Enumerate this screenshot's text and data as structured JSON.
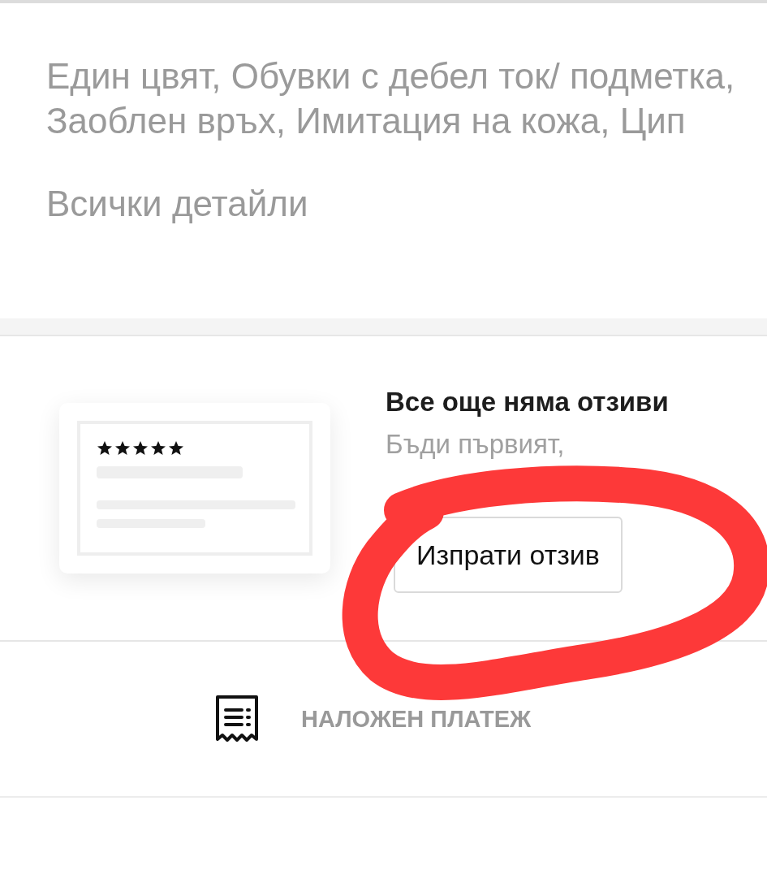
{
  "product": {
    "description": "Един цвят, Обувки с дебел ток/ подметка, Заоблен връх, Имитация на кожа, Цип",
    "details_link": "Всички детайли"
  },
  "reviews": {
    "card": {
      "stars": 5
    },
    "title": "Все още няма отзиви",
    "subtitle": "Бъди първият,",
    "button": "Изпрати отзив"
  },
  "payment": {
    "label": "НАЛОЖЕН ПЛАТЕЖ"
  }
}
